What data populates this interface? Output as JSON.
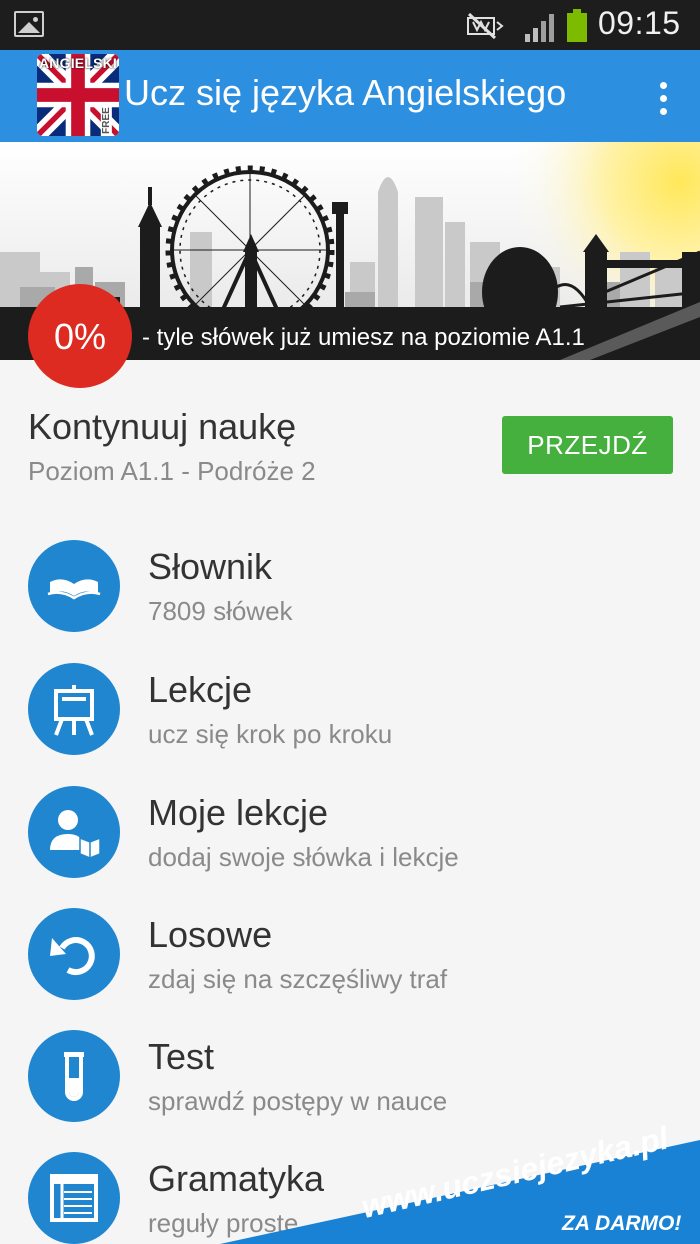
{
  "status_bar": {
    "time": "09:15",
    "icons": [
      "image-notification-icon",
      "mute-icon",
      "signal-icon",
      "battery-icon"
    ],
    "battery_color": "#7dbb00"
  },
  "action_bar": {
    "title": "Ucz się języka Angielskiego",
    "icon_label": "ANGIELSKI",
    "icon_badge": "FREE",
    "background": "#2d8fe0"
  },
  "banner": {
    "progress": "0%",
    "progress_text": "- tyle słówek już umiesz na poziomie A1.1",
    "progress_color": "#dd2b22"
  },
  "continue": {
    "title": "Kontynuuj naukę",
    "subtitle": "Poziom A1.1 - Podróże 2",
    "button_label": "PRZEJDŹ",
    "button_color": "#45b03d"
  },
  "menu": [
    {
      "icon": "book-icon",
      "title": "Słownik",
      "subtitle": "7809 słówek"
    },
    {
      "icon": "easel-icon",
      "title": "Lekcje",
      "subtitle": "ucz się krok po kroku"
    },
    {
      "icon": "user-book-icon",
      "title": "Moje lekcje",
      "subtitle": "dodaj swoje słówka i lekcje"
    },
    {
      "icon": "refresh-icon",
      "title": "Losowe",
      "subtitle": "zdaj się na szczęśliwy traf"
    },
    {
      "icon": "test-tube-icon",
      "title": "Test",
      "subtitle": "sprawdź postępy w nauce"
    },
    {
      "icon": "grammar-table-icon",
      "title": "Gramatyka",
      "subtitle": "reguły proste"
    }
  ],
  "promo": {
    "url": "www.uczsiejezyka.pl",
    "free_label": "ZA DARMO!",
    "color": "#1a82d4"
  },
  "accent_color": "#1f86cf"
}
